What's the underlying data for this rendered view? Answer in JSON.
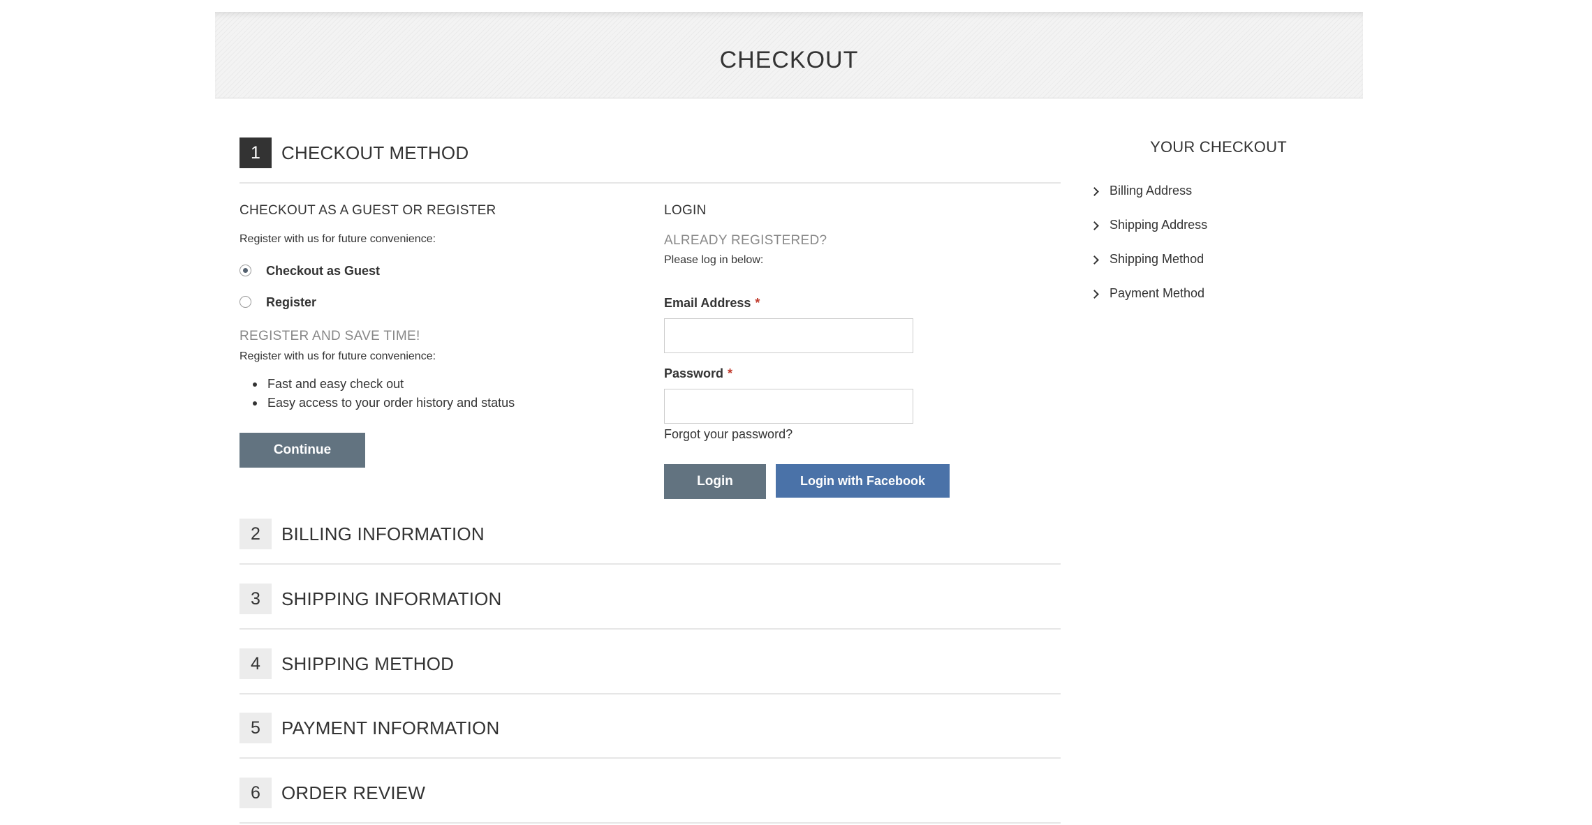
{
  "banner": {
    "title": "CHECKOUT"
  },
  "steps": [
    {
      "number": "1",
      "title": "CHECKOUT METHOD"
    },
    {
      "number": "2",
      "title": "BILLING INFORMATION"
    },
    {
      "number": "3",
      "title": "SHIPPING INFORMATION"
    },
    {
      "number": "4",
      "title": "SHIPPING METHOD"
    },
    {
      "number": "5",
      "title": "PAYMENT INFORMATION"
    },
    {
      "number": "6",
      "title": "ORDER REVIEW"
    }
  ],
  "guest": {
    "title": "CHECKOUT AS A GUEST OR REGISTER",
    "intro": "Register with us for future convenience:",
    "options": [
      {
        "label": "Checkout as Guest",
        "checked": true
      },
      {
        "label": "Register",
        "checked": false
      }
    ],
    "register_title": "REGISTER AND SAVE TIME!",
    "register_intro": "Register with us for future convenience:",
    "benefits": [
      "Fast and easy check out",
      "Easy access to your order history and status"
    ],
    "continue_label": "Continue"
  },
  "login": {
    "title": "LOGIN",
    "already_registered": "ALREADY REGISTERED?",
    "please_log_in": "Please log in below:",
    "email_label": "Email Address",
    "email_value": "",
    "password_label": "Password",
    "password_value": "",
    "required_mark": "*",
    "forgot_label": "Forgot your password?",
    "login_label": "Login",
    "facebook_label": "Login with Facebook"
  },
  "sidebar": {
    "title": "YOUR CHECKOUT",
    "items": [
      "Billing Address",
      "Shipping Address",
      "Shipping Method",
      "Payment Method"
    ]
  },
  "colors": {
    "button_grey": "#627380",
    "button_facebook": "#4a72a8",
    "active_step_bg": "#333333",
    "inactive_step_bg": "#ececec",
    "subhead_grey": "#888888",
    "required": "#c0392b"
  }
}
